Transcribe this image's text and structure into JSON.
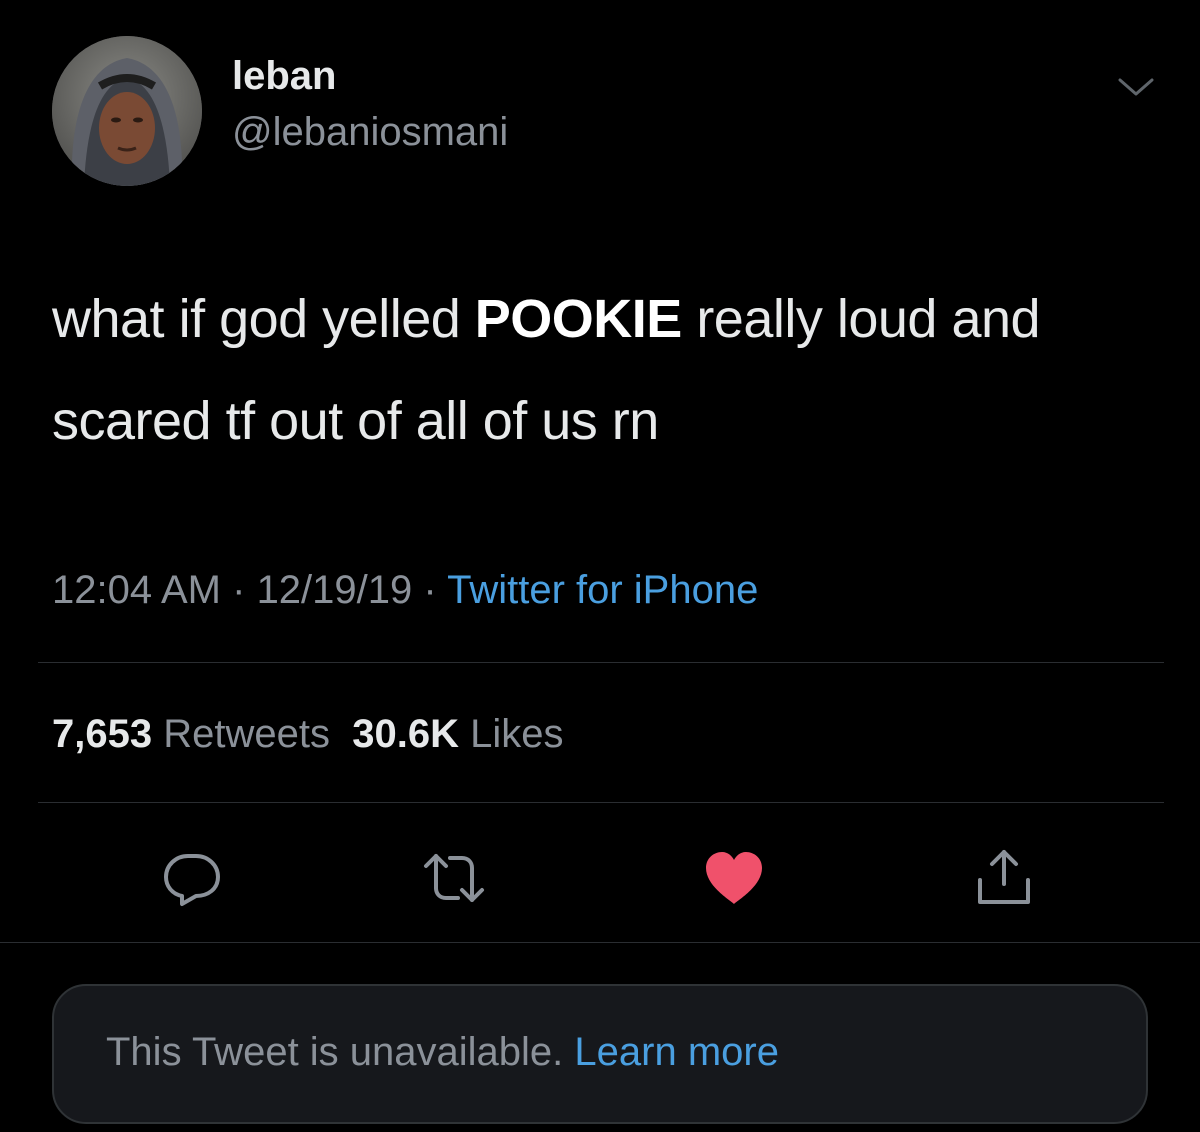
{
  "tweet": {
    "author": {
      "display_name": "leban",
      "handle": "@lebaniosmani"
    },
    "text_before": "what if god yelled ",
    "text_emphasis": "POOKIE",
    "text_after": " really loud and scared tf out of all of us rn",
    "time": "12:04 AM",
    "date": "12/19/19",
    "separator": " · ",
    "source": "Twitter for iPhone",
    "stats": {
      "retweets_count": "7,653",
      "retweets_label": "Retweets",
      "likes_count": "30.6K",
      "likes_label": "Likes"
    },
    "actions": {
      "reply_icon": "reply-icon",
      "retweet_icon": "retweet-icon",
      "like_icon": "heart-icon",
      "share_icon": "share-icon",
      "liked": true
    }
  },
  "quoted": {
    "message": "This Tweet is unavailable.",
    "link": "Learn more"
  },
  "colors": {
    "background": "#000000",
    "primary_text": "#e7e9ea",
    "secondary_text": "#8b9199",
    "link": "#4a9fe0",
    "like": "#f0516b"
  }
}
